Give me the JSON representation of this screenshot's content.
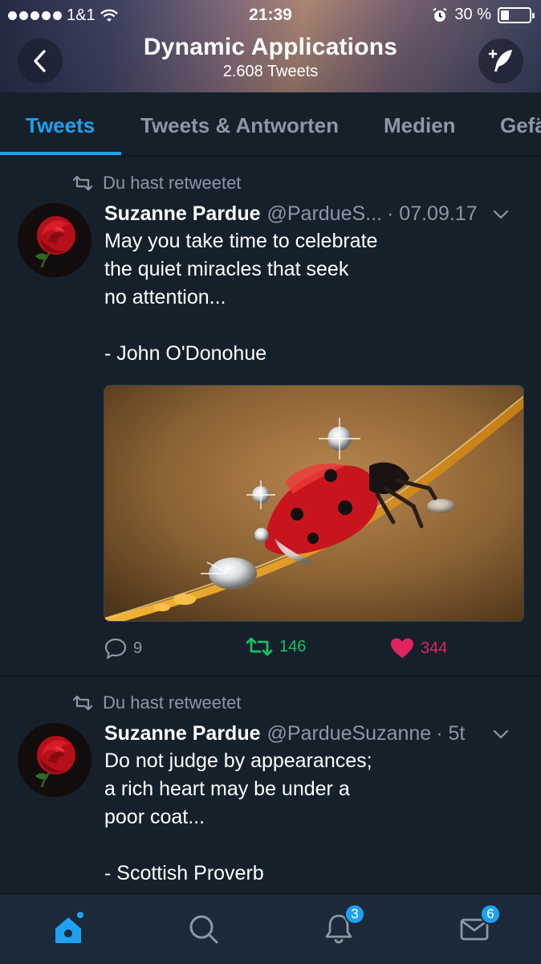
{
  "status_bar": {
    "carrier": "1&1",
    "time": "21:39",
    "battery": "30 %",
    "battery_level": 0.3
  },
  "header": {
    "title": "Dynamic Applications",
    "subtitle": "2.608 Tweets",
    "back_icon": "chevron-left-icon",
    "compose_icon": "compose-tweet-icon"
  },
  "tabs": [
    {
      "label": "Tweets",
      "active": true
    },
    {
      "label": "Tweets & Antworten",
      "active": false
    },
    {
      "label": "Medien",
      "active": false
    },
    {
      "label": "Gefä",
      "active": false
    }
  ],
  "tweets": [
    {
      "retweet_note": "Du hast retweetet",
      "name": "Suzanne Pardue",
      "handle": "@PardueS...",
      "date": "· 07.09.17",
      "text": "May you take time to celebrate\nthe quiet miracles that seek\nno attention...\n\n- John O'Donohue",
      "replies": "9",
      "retweets": "146",
      "likes": "344"
    },
    {
      "retweet_note": "Du hast retweetet",
      "name": "Suzanne Pardue",
      "handle": "@PardueSuzanne",
      "date": "· 5t",
      "text": "Do not judge by appearances;\na rich heart may be under a\npoor coat...\n\n- Scottish Proverb"
    }
  ],
  "bottom_nav": {
    "notifications_badge": "3",
    "messages_badge": "6"
  },
  "colors": {
    "background": "#15202b",
    "accent": "#1da1f2",
    "retweet_green": "#17bf63",
    "like_red": "#e0245e",
    "muted": "#8b98a5"
  }
}
